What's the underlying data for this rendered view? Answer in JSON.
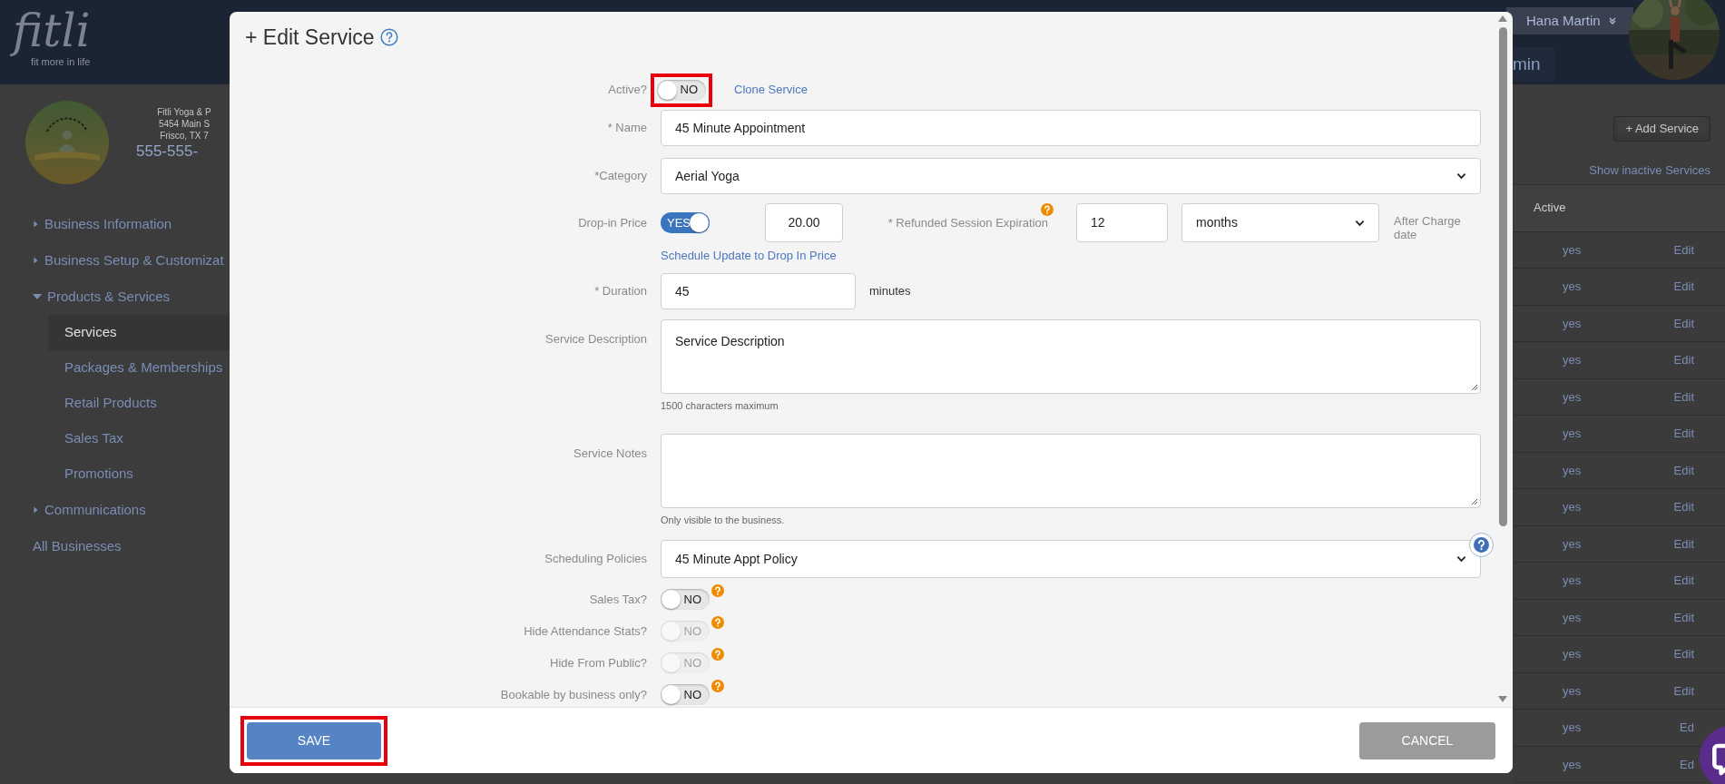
{
  "header": {
    "logo": "fitli",
    "tagline": "fit more in life",
    "user_name": "Hana Martin",
    "tab_label": "min"
  },
  "business": {
    "lines": [
      "Fitli Yoga & P",
      "5454 Main S",
      "Frisco, TX 7"
    ],
    "phone": "555-555-"
  },
  "sidebar": {
    "items": [
      {
        "label": "Business Information",
        "kind": "group",
        "expanded": false,
        "selected": false
      },
      {
        "label": "Business Setup & Customizat",
        "kind": "group",
        "expanded": false,
        "selected": false
      },
      {
        "label": "Products & Services",
        "kind": "group",
        "expanded": true,
        "selected": false,
        "children": [
          {
            "label": "Services",
            "selected": true
          },
          {
            "label": "Packages & Memberships",
            "selected": false
          },
          {
            "label": "Retail Products",
            "selected": false
          },
          {
            "label": "Sales Tax",
            "selected": false
          },
          {
            "label": "Promotions",
            "selected": false
          }
        ]
      },
      {
        "label": "Communications",
        "kind": "group",
        "expanded": false,
        "selected": false
      },
      {
        "label": "All Businesses",
        "kind": "link",
        "selected": false
      }
    ]
  },
  "services": {
    "add_button": "+ Add Service",
    "show_inactive_link": "Show inactive Services",
    "columns": [
      "Active"
    ],
    "rows": [
      {
        "active": "yes",
        "action": "Edit"
      },
      {
        "active": "yes",
        "action": "Edit"
      },
      {
        "active": "yes",
        "action": "Edit"
      },
      {
        "active": "yes",
        "action": "Edit"
      },
      {
        "active": "yes",
        "action": "Edit"
      },
      {
        "active": "yes",
        "action": "Edit"
      },
      {
        "active": "yes",
        "action": "Edit"
      },
      {
        "active": "yes",
        "action": "Edit"
      },
      {
        "active": "yes",
        "action": "Edit"
      },
      {
        "active": "yes",
        "action": "Edit"
      },
      {
        "active": "yes",
        "action": "Edit"
      },
      {
        "active": "yes",
        "action": "Edit"
      },
      {
        "active": "yes",
        "action": "Edit"
      },
      {
        "active": "yes",
        "action": "Ed"
      },
      {
        "active": "yes",
        "action": "Ed"
      }
    ]
  },
  "modal": {
    "title": "+ Edit Service",
    "active": {
      "label": "Active?",
      "on": false,
      "disabled": false,
      "state_text": "NO",
      "highlighted": true
    },
    "clone_link": "Clone Service",
    "name": {
      "label": "* Name",
      "value": "45 Minute Appointment"
    },
    "category": {
      "label": "*Category",
      "value": "Aerial Yoga"
    },
    "drop_in": {
      "label": "Drop-in Price",
      "toggle": {
        "on": true,
        "disabled": false,
        "state_text": "YES"
      },
      "price": "20.00"
    },
    "refund": {
      "label": "* Refunded Session Expiration",
      "value": "12",
      "unit": "months",
      "note": "After Charge date"
    },
    "schedule_update_link": "Schedule Update to Drop In Price",
    "duration": {
      "label": "* Duration",
      "value": "45",
      "unit": "minutes"
    },
    "description": {
      "label": "Service Description",
      "value": "Service Description",
      "hint": "1500 characters maximum"
    },
    "notes": {
      "label": "Service Notes",
      "hint": "Only visible to the business."
    },
    "scheduling": {
      "label": "Scheduling Policies",
      "value": "45 Minute Appt Policy"
    },
    "toggles": [
      {
        "label": "Sales Tax?",
        "on": false,
        "disabled": false,
        "state_text": "NO"
      },
      {
        "label": "Hide Attendance Stats?",
        "on": false,
        "disabled": true,
        "state_text": "NO"
      },
      {
        "label": "Hide From Public?",
        "on": false,
        "disabled": true,
        "state_text": "NO"
      },
      {
        "label": "Bookable by business only?",
        "on": false,
        "disabled": false,
        "state_text": "NO"
      }
    ],
    "save_button": {
      "label": "SAVE",
      "highlighted": true
    },
    "cancel_button": "CANCEL"
  }
}
